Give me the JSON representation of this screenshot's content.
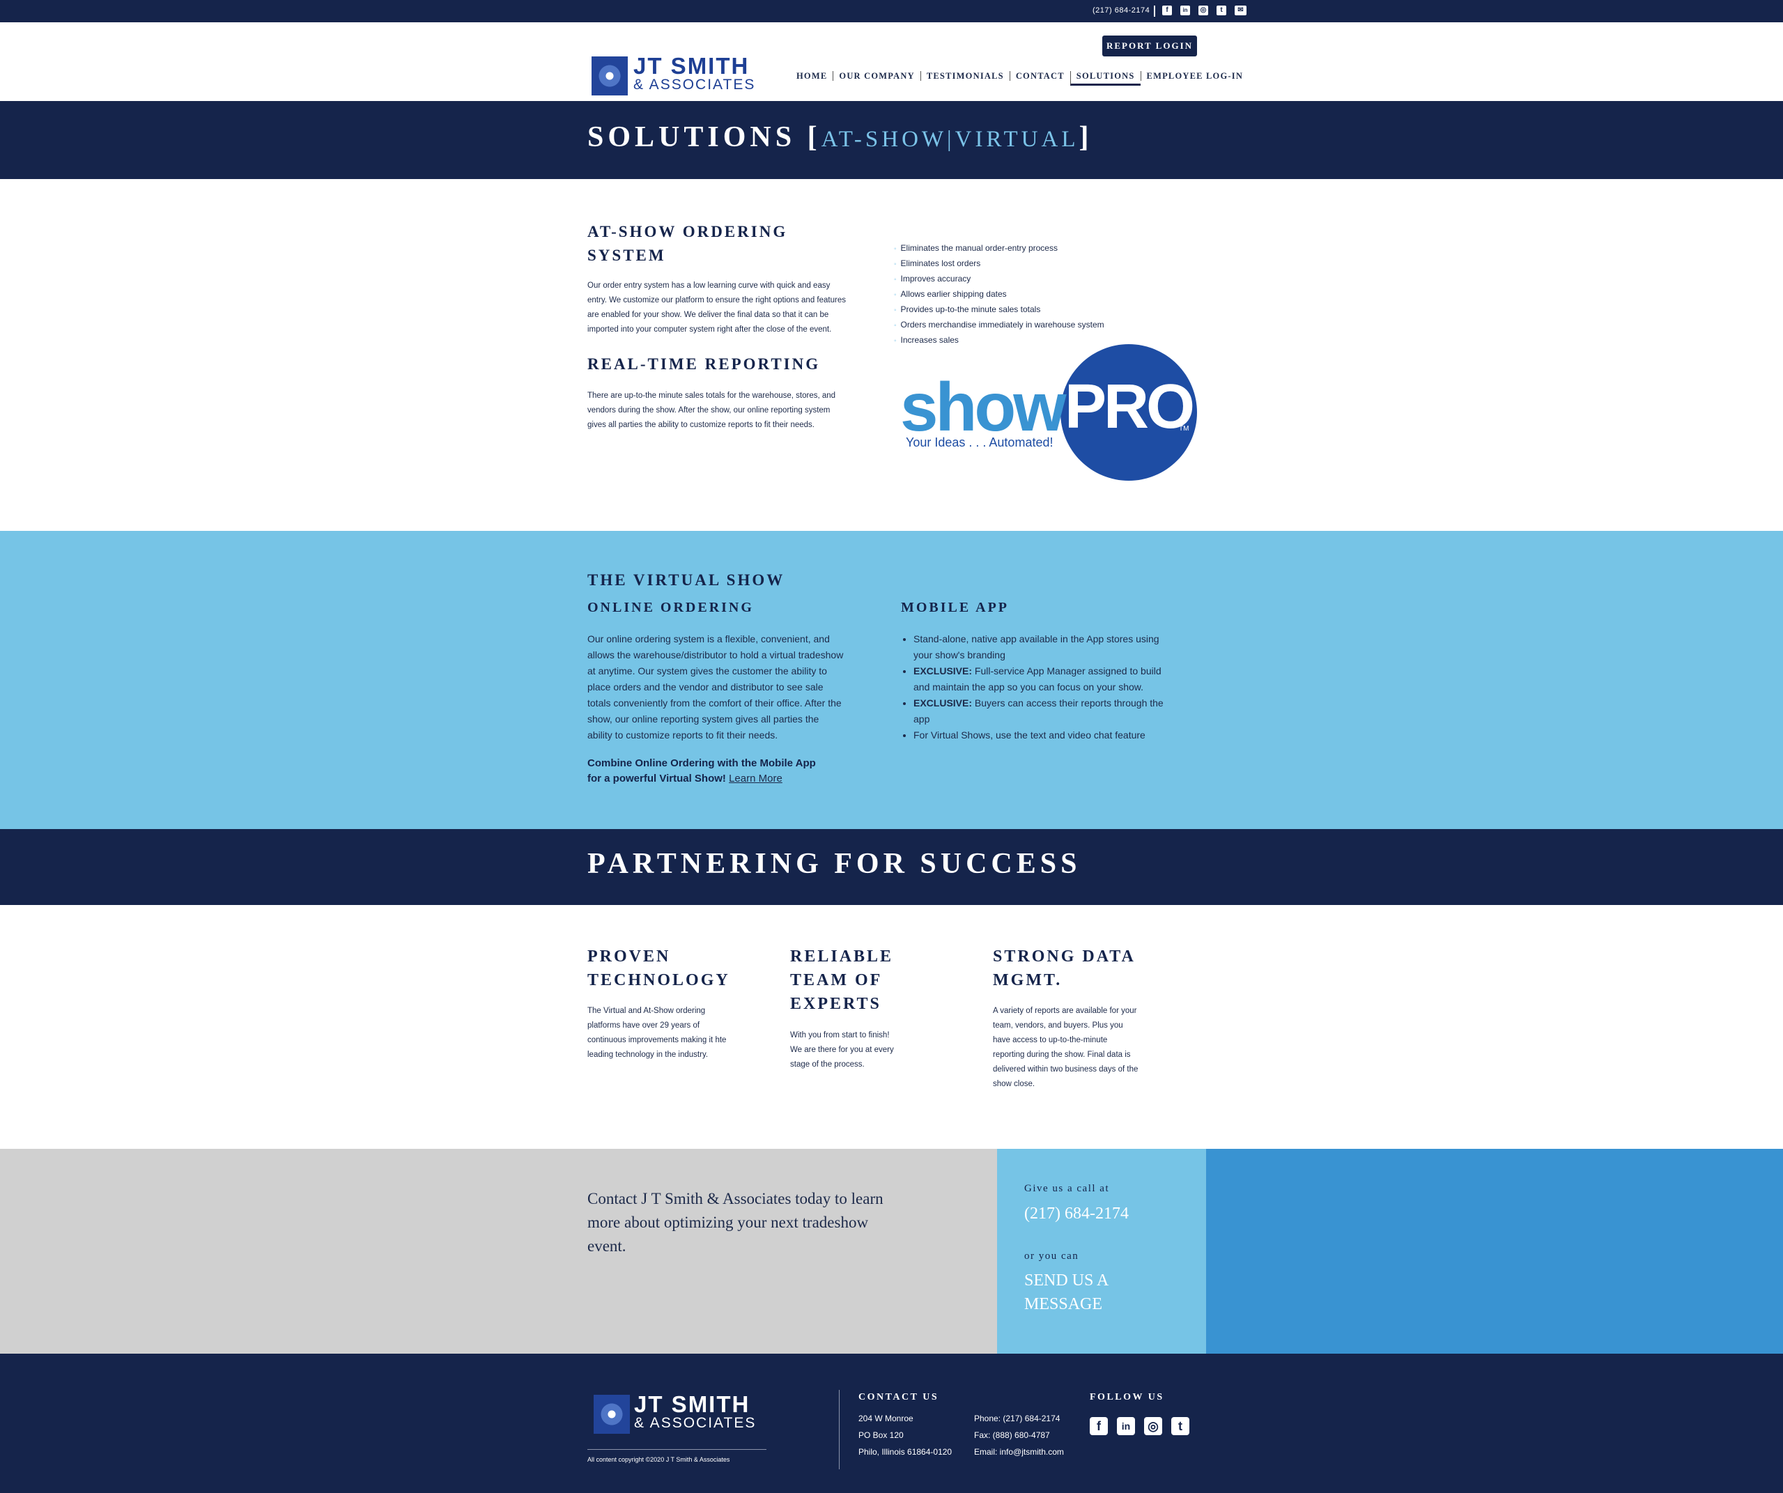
{
  "topbar": {
    "phone": "(217) 684-2174"
  },
  "icons": {
    "facebook": "facebook-icon",
    "linkedin": "linkedin-icon",
    "instagram": "instagram-icon",
    "twitter": "twitter-icon",
    "email": "email-icon"
  },
  "colors": {
    "navy": "#15244b",
    "light_blue": "#76c4e6",
    "mid_blue": "#3993d2",
    "gray": "#d0d0d0",
    "brand_blue": "#1e3f94"
  },
  "logo": {
    "line1": "JT SMITH",
    "line2": "& ASSOCIATES"
  },
  "header": {
    "report_login": "REPORT LOGIN",
    "nav": [
      "HOME",
      "OUR COMPANY",
      "TESTIMONIALS",
      "CONTACT",
      "SOLUTIONS",
      "EMPLOYEE LOG-IN"
    ],
    "active_nav": "SOLUTIONS"
  },
  "solutions": {
    "title": "SOLUTIONS",
    "bracket_open": "[",
    "bracket_close": "]",
    "subtitle": "AT-SHOW|VIRTUAL"
  },
  "atshow": {
    "heading_line1": "AT-SHOW ORDERING",
    "heading_line2": "SYSTEM",
    "body": [
      "Our order entry system has a low learning curve with quick and easy",
      "entry. We customize our platform to ensure the right options and features",
      "are enabled for your show. We deliver the final data so that it can be",
      "imported into your computer system right after the close of the event."
    ],
    "reporting_heading": "REAL-TIME REPORTING",
    "reporting_body": [
      "There are up-to-the minute sales totals for the warehouse, stores, and",
      "vendors during the show. After the show, our online reporting system",
      "gives all parties the ability to customize reports to fit their needs."
    ],
    "benefits": [
      "Eliminates the manual order-entry process",
      "Eliminates lost orders",
      "Improves accuracy",
      "Allows earlier shipping dates",
      "Provides up-to-the minute sales totals",
      "Orders merchandise immediately in warehouse system",
      "Increases sales"
    ]
  },
  "showpro": {
    "show": "show",
    "pro": "PRO",
    "tagline": "Your Ideas . . . Automated!",
    "tm": "TM"
  },
  "virtual": {
    "heading": "THE VIRTUAL SHOW",
    "online_heading": "ONLINE ORDERING",
    "online_body": [
      "Our online ordering system is a flexible, convenient, and",
      "allows the warehouse/distributor to hold a virtual tradeshow",
      "at anytime. Our system gives the customer the ability to",
      "place orders and the vendor and distributor to see sale",
      "totals conveniently from the comfort of their office. After the",
      "show, our online reporting system gives all parties the",
      "ability to customize reports to fit their needs."
    ],
    "combine_line1": "Combine Online Ordering with the Mobile App",
    "combine_line2": "for a powerful Virtual Show!",
    "learn_more": "Learn More",
    "mobile_heading": "MOBILE APP",
    "mobile_items": [
      {
        "bold": "",
        "text": "Stand-alone, native app available in the App stores using your show's branding"
      },
      {
        "bold": "EXCLUSIVE:",
        "text": " Full-service App Manager assigned to build and maintain the app so you can focus on your show."
      },
      {
        "bold": "EXCLUSIVE:",
        "text": " Buyers can access their reports through the app"
      },
      {
        "bold": "",
        "text": "For Virtual Shows, use the text and video chat feature"
      }
    ]
  },
  "partnering": {
    "title": "PARTNERING FOR SUCCESS",
    "col1_heading": [
      "PROVEN",
      "TECHNOLOGY"
    ],
    "col1_body": [
      "The Virtual and At-Show ordering",
      "platforms have over 29 years of",
      "continuous improvements making it hte",
      "leading technology in the industry."
    ],
    "col2_heading": [
      "RELIABLE",
      "TEAM OF",
      "EXPERTS"
    ],
    "col2_body": [
      "With you from start to finish!",
      "We are there for you at every",
      "stage of the process."
    ],
    "col3_heading": [
      "STRONG DATA",
      "MGMT."
    ],
    "col3_body": [
      "A variety of reports are available for your",
      "team, vendors, and buyers. Plus you",
      "have access to up-to-the-minute",
      "reporting during the show. Final data is",
      "delivered within two business days of the",
      "show close."
    ]
  },
  "contact_band": {
    "text": "Contact J T Smith & Associates today to learn more about optimizing your next tradeshow event.",
    "call_label": "Give us a call at",
    "phone": "(217) 684-2174",
    "or_label": "or you can",
    "send_line1": "SEND US A",
    "send_line2": "MESSAGE"
  },
  "footer": {
    "copyright": "All content copyright ©2020 J T Smith & Associates",
    "contact_heading": "CONTACT US",
    "address": [
      "204 W Monroe",
      "PO Box 120",
      "Philo, Illinois 61864-0120"
    ],
    "phones": [
      "Phone: (217) 684-2174",
      "Fax: (888) 680-4787",
      "Email: info@jtsmith.com"
    ],
    "follow_heading": "FOLLOW US"
  }
}
